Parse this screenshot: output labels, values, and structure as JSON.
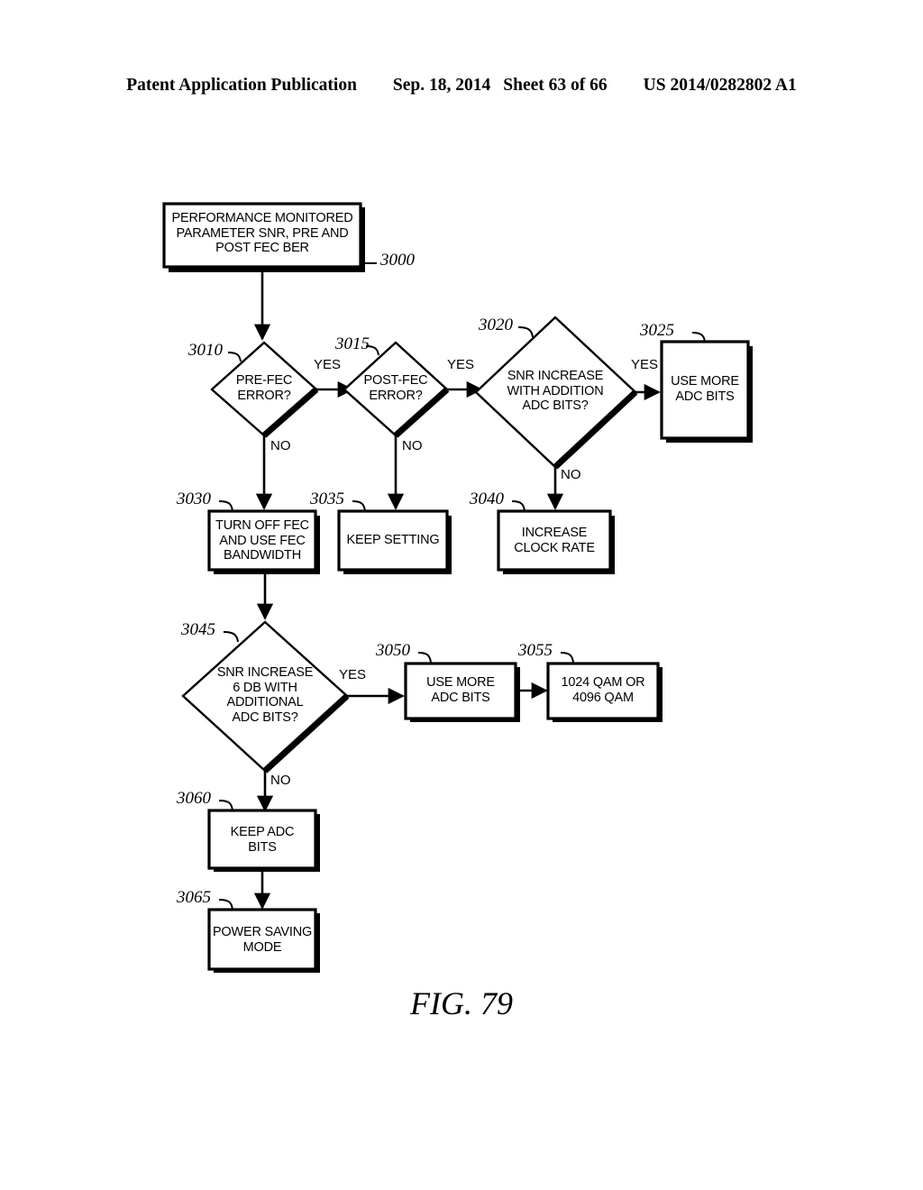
{
  "header": {
    "publication": "Patent Application Publication",
    "date": "Sep. 18, 2014",
    "sheet": "Sheet 63 of 66",
    "patent_number": "US 2014/0282802 A1"
  },
  "figure": {
    "caption": "FIG. 79"
  },
  "colors": {
    "ink": "#000000",
    "paper": "#ffffff"
  },
  "nodes": [
    {
      "id": "3000",
      "ref": "3000",
      "shape": "process",
      "lines": [
        "PERFORMANCE MONITORED",
        "PARAMETER SNR, PRE AND",
        "POST FEC BER"
      ]
    },
    {
      "id": "3010",
      "ref": "3010",
      "shape": "decision",
      "lines": [
        "PRE-FEC",
        "ERROR?"
      ]
    },
    {
      "id": "3015",
      "ref": "3015",
      "shape": "decision",
      "lines": [
        "POST-FEC",
        "ERROR?"
      ]
    },
    {
      "id": "3020",
      "ref": "3020",
      "shape": "decision",
      "lines": [
        "SNR INCREASE",
        "WITH ADDITION",
        "ADC BITS?"
      ]
    },
    {
      "id": "3025",
      "ref": "3025",
      "shape": "process",
      "lines": [
        "USE MORE",
        "ADC BITS"
      ]
    },
    {
      "id": "3030",
      "ref": "3030",
      "shape": "process",
      "lines": [
        "TURN OFF FEC",
        "AND USE FEC",
        "BANDWIDTH"
      ]
    },
    {
      "id": "3035",
      "ref": "3035",
      "shape": "process",
      "lines": [
        "KEEP SETTING"
      ]
    },
    {
      "id": "3040",
      "ref": "3040",
      "shape": "process",
      "lines": [
        "INCREASE",
        "CLOCK RATE"
      ]
    },
    {
      "id": "3045",
      "ref": "3045",
      "shape": "decision",
      "lines": [
        "SNR INCREASE",
        "6 DB WITH",
        "ADDITIONAL",
        "ADC BITS?"
      ]
    },
    {
      "id": "3050",
      "ref": "3050",
      "shape": "process",
      "lines": [
        "USE MORE",
        "ADC BITS"
      ]
    },
    {
      "id": "3055",
      "ref": "3055",
      "shape": "process",
      "lines": [
        "1024 QAM OR",
        "4096 QAM"
      ]
    },
    {
      "id": "3060",
      "ref": "3060",
      "shape": "process",
      "lines": [
        "KEEP ADC",
        "BITS"
      ]
    },
    {
      "id": "3065",
      "ref": "3065",
      "shape": "process",
      "lines": [
        "POWER SAVING",
        "MODE"
      ]
    }
  ],
  "edges": [
    {
      "from": "3000",
      "to": "3010",
      "label": ""
    },
    {
      "from": "3010",
      "to": "3015",
      "label": "YES"
    },
    {
      "from": "3010",
      "to": "3030",
      "label": "NO"
    },
    {
      "from": "3015",
      "to": "3020",
      "label": "YES"
    },
    {
      "from": "3015",
      "to": "3035",
      "label": "NO"
    },
    {
      "from": "3020",
      "to": "3025",
      "label": "YES"
    },
    {
      "from": "3020",
      "to": "3040",
      "label": "NO"
    },
    {
      "from": "3030",
      "to": "3045",
      "label": ""
    },
    {
      "from": "3045",
      "to": "3050",
      "label": "YES"
    },
    {
      "from": "3045",
      "to": "3060",
      "label": "NO"
    },
    {
      "from": "3050",
      "to": "3055",
      "label": ""
    },
    {
      "from": "3060",
      "to": "3065",
      "label": ""
    }
  ]
}
